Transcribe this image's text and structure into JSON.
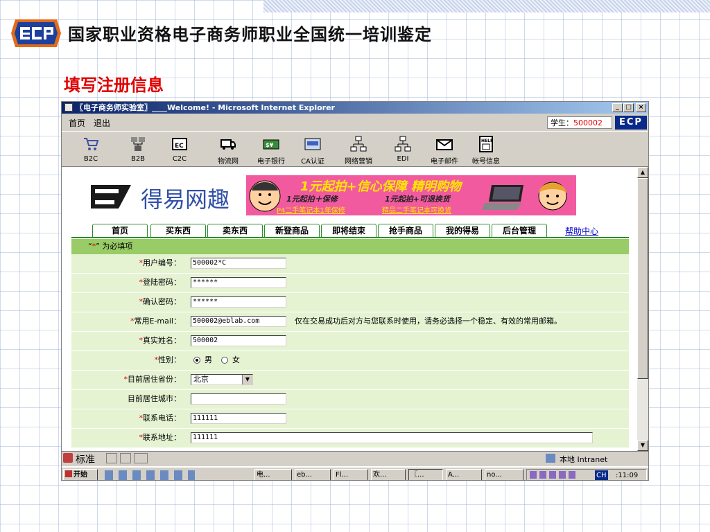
{
  "slide": {
    "title": "国家职业资格电子商务师职业全国统一培训鉴定",
    "subtitle": "填写注册信息",
    "logo_text": "ECP"
  },
  "window": {
    "title": "〖电子商务师实验室〗____Welcome! - Microsoft Internet Explorer",
    "min": "_",
    "max": "□",
    "close": "×"
  },
  "menubar": {
    "home": "首页",
    "logout": "退出",
    "student_label": "学生：",
    "student_id": "500002",
    "badge": "ECP"
  },
  "toolbar": [
    {
      "label": "B2C",
      "icon": "cart-icon"
    },
    {
      "label": "B2B",
      "icon": "network-icon"
    },
    {
      "label": "C2C",
      "icon": "ec-icon"
    },
    {
      "label": "物流网",
      "icon": "truck-icon"
    },
    {
      "label": "电子银行",
      "icon": "money-icon"
    },
    {
      "label": "CA认证",
      "icon": "certificate-icon"
    },
    {
      "label": "网络营销",
      "icon": "hierarchy-icon"
    },
    {
      "label": "EDI",
      "icon": "edi-icon"
    },
    {
      "label": "电子邮件",
      "icon": "mail-icon"
    },
    {
      "label": "帐号信息",
      "icon": "help-icon"
    }
  ],
  "site": {
    "logo_text": "得易网趣",
    "banner_headline": "1元起拍+信心保障 精明购物",
    "banner_line1": "1元起拍＋保修",
    "banner_line2": "1元起拍+可退换货",
    "banner_link1": "P4二手笔记本1年保修",
    "banner_link2": "精品二手笔记本可换货",
    "nav": [
      "首页",
      "买东西",
      "卖东西",
      "新登商品",
      "即将结束",
      "抢手商品",
      "我的得易",
      "后台管理"
    ],
    "help": "帮助中心"
  },
  "form": {
    "required_note_prefix": "“",
    "required_star": "*",
    "required_note_suffix": "” 为必填项",
    "star": "*",
    "user_id_label": "用户编号：",
    "user_id": "500002*C",
    "password_label": "登陆密码：",
    "password": "******",
    "confirm_label": "确认密码：",
    "confirm": "******",
    "email_label": "常用E-mail：",
    "email": "500002@eblab.com",
    "email_note": "仅在交易成功后对方与您联系时使用，请务必选择一个稳定、有效的常用邮箱。",
    "realname_label": "真实姓名：",
    "realname": "500002",
    "gender_label": "性别：",
    "male": "男",
    "female": "女",
    "province_label": "目前居住省份：",
    "province": "北京",
    "city_label": "目前居住城市：",
    "city": "",
    "phone_label": "联系电话：",
    "phone": "111111",
    "address_label": "联系地址：",
    "address": "111111"
  },
  "statusbar": {
    "ime": "标准",
    "zone": "本地 Intranet"
  },
  "taskbar": {
    "start": "开始",
    "items": [
      "电...",
      "eb...",
      "Fl...",
      "欢...",
      "〖...",
      "A...",
      "no..."
    ],
    "lang": "CH",
    "clock": ":11:09"
  },
  "colors": {
    "accent_red": "#e00000",
    "form_green": "#99cc66",
    "form_row": "#e6f3d3",
    "title_blue": "#0a246a"
  }
}
